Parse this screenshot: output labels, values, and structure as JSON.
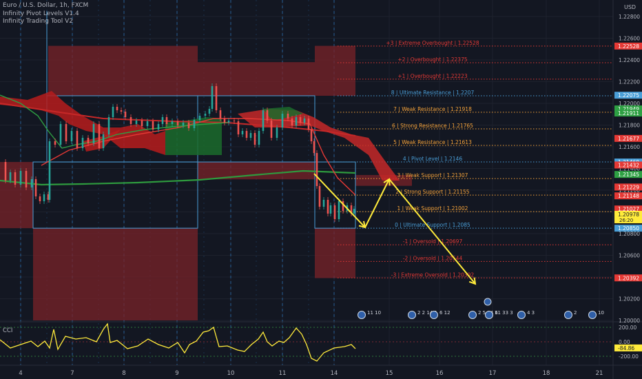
{
  "header": {
    "symbol": "Euro / U.S. Dollar, 1h, FXCM",
    "indicators": [
      "Infinity Pivot Levels V1.4",
      "Infinity Trading Tool V2"
    ]
  },
  "axis": {
    "currency": "USD",
    "sub_label": "CCI"
  },
  "colors": {
    "background": "#131722",
    "grid": "#1e222d",
    "orange": "#f7a43a",
    "red": "#e53935",
    "blue": "#4a9fd8",
    "green": "#2ea043",
    "dark_green": "#1b6b2b",
    "yellow": "#ffeb3b",
    "zone_red": "#7a2328",
    "white": "#d1d4dc"
  },
  "chart_data": {
    "type": "line",
    "title": "Euro / U.S. Dollar, 1h, FXCM",
    "ylim": [
      1.2,
      1.228
    ],
    "y_ticks": [
      "1.22800",
      "1.22600",
      "1.22400",
      "1.22200",
      "1.22000",
      "1.21800",
      "1.21600",
      "1.21400",
      "1.21200",
      "1.21000",
      "1.20800",
      "1.20600",
      "1.20400",
      "1.20200",
      "1.20000"
    ],
    "x_ticks": [
      "4",
      "7",
      "8",
      "9",
      "10",
      "11",
      "14",
      "15",
      "16",
      "17",
      "18",
      "21"
    ],
    "price_tags": [
      {
        "text": "1.22528",
        "value": 1.22528,
        "color": "#e53935"
      },
      {
        "text": "1.22075",
        "value": 1.22075,
        "color": "#4a9fd8"
      },
      {
        "text": "1.21949",
        "value": 1.21949,
        "color": "#2ea043"
      },
      {
        "text": "1.21911",
        "value": 1.21911,
        "color": "#2ea043"
      },
      {
        "text": "1.21677",
        "value": 1.21677,
        "color": "#e53935"
      },
      {
        "text": "1.21460",
        "value": 1.2146,
        "color": "#4a9fd8"
      },
      {
        "text": "1.21432",
        "value": 1.21432,
        "color": "#e53935"
      },
      {
        "text": "1.21432",
        "value": 1.21432,
        "color": "#e53935"
      },
      {
        "text": "1.21345",
        "value": 1.21345,
        "color": "#2ea043"
      },
      {
        "text": "1.21229",
        "value": 1.21229,
        "color": "#e53935"
      },
      {
        "text": "1.21229",
        "value": 1.21229,
        "color": "#e53935"
      },
      {
        "text": "1.21148",
        "value": 1.21148,
        "color": "#e53935"
      },
      {
        "text": "1.21027",
        "value": 1.21027,
        "color": "#e53935"
      },
      {
        "text": "1.20978",
        "value": 1.20978,
        "color": "#ffeb3b",
        "sub": "26:20"
      },
      {
        "text": "1.20850",
        "value": 1.2085,
        "color": "#4a9fd8"
      },
      {
        "text": "1.20392",
        "value": 1.20392,
        "color": "#e53935"
      }
    ],
    "levels": [
      {
        "label": "+3 | Extreme Overbought  |  1.22528",
        "value": 1.22528,
        "color": "#e53935"
      },
      {
        "label": "+2 | Overbought  |  1.22375",
        "value": 1.22375,
        "color": "#e53935"
      },
      {
        "label": "+1 | Overbought  |  1.22223",
        "value": 1.22223,
        "color": "#e53935"
      },
      {
        "label": "8 | Ultimate Resistance  |  1.2207",
        "value": 1.2207,
        "color": "#4a9fd8"
      },
      {
        "label": "7 | Weak Resistance  |  1.21918",
        "value": 1.21918,
        "color": "#f7a43a"
      },
      {
        "label": "6 | Strong Resistance  |  1.21765",
        "value": 1.21765,
        "color": "#f7a43a"
      },
      {
        "label": "5 | Weak Resistance  |  1.21613",
        "value": 1.21613,
        "color": "#f7a43a"
      },
      {
        "label": "4 | Pivot Level  |  1.2146",
        "value": 1.2146,
        "color": "#4a9fd8"
      },
      {
        "label": "3 | Weak Support  |  1.21307",
        "value": 1.21307,
        "color": "#f7a43a"
      },
      {
        "label": "2 | Strong Support  |  1.21155",
        "value": 1.21155,
        "color": "#f7a43a"
      },
      {
        "label": "1 | Weak Support  |  1.21002",
        "value": 1.21002,
        "color": "#f7a43a"
      },
      {
        "label": "0 | Ultimate Support  |  1.2085",
        "value": 1.2085,
        "color": "#4a9fd8"
      },
      {
        "label": "-1 | Oversold  |  1.20697",
        "value": 1.20697,
        "color": "#e53935"
      },
      {
        "label": "-2 | Oversold  |  1.20544",
        "value": 1.20544,
        "color": "#e53935"
      },
      {
        "label": "-3 | Extreme Oversold  |  1.20392",
        "value": 1.20392,
        "color": "#e53935"
      }
    ],
    "cci": {
      "ylim": [
        -200,
        200
      ],
      "ticks": [
        "200.00",
        "0.00",
        "-200.00"
      ],
      "last_value": "-84.86"
    },
    "event_labels": [
      "11 10",
      "2 2 14 1",
      "6 12",
      "2 5 14 6",
      "11 33 3",
      "4 3",
      "2",
      "10"
    ]
  }
}
